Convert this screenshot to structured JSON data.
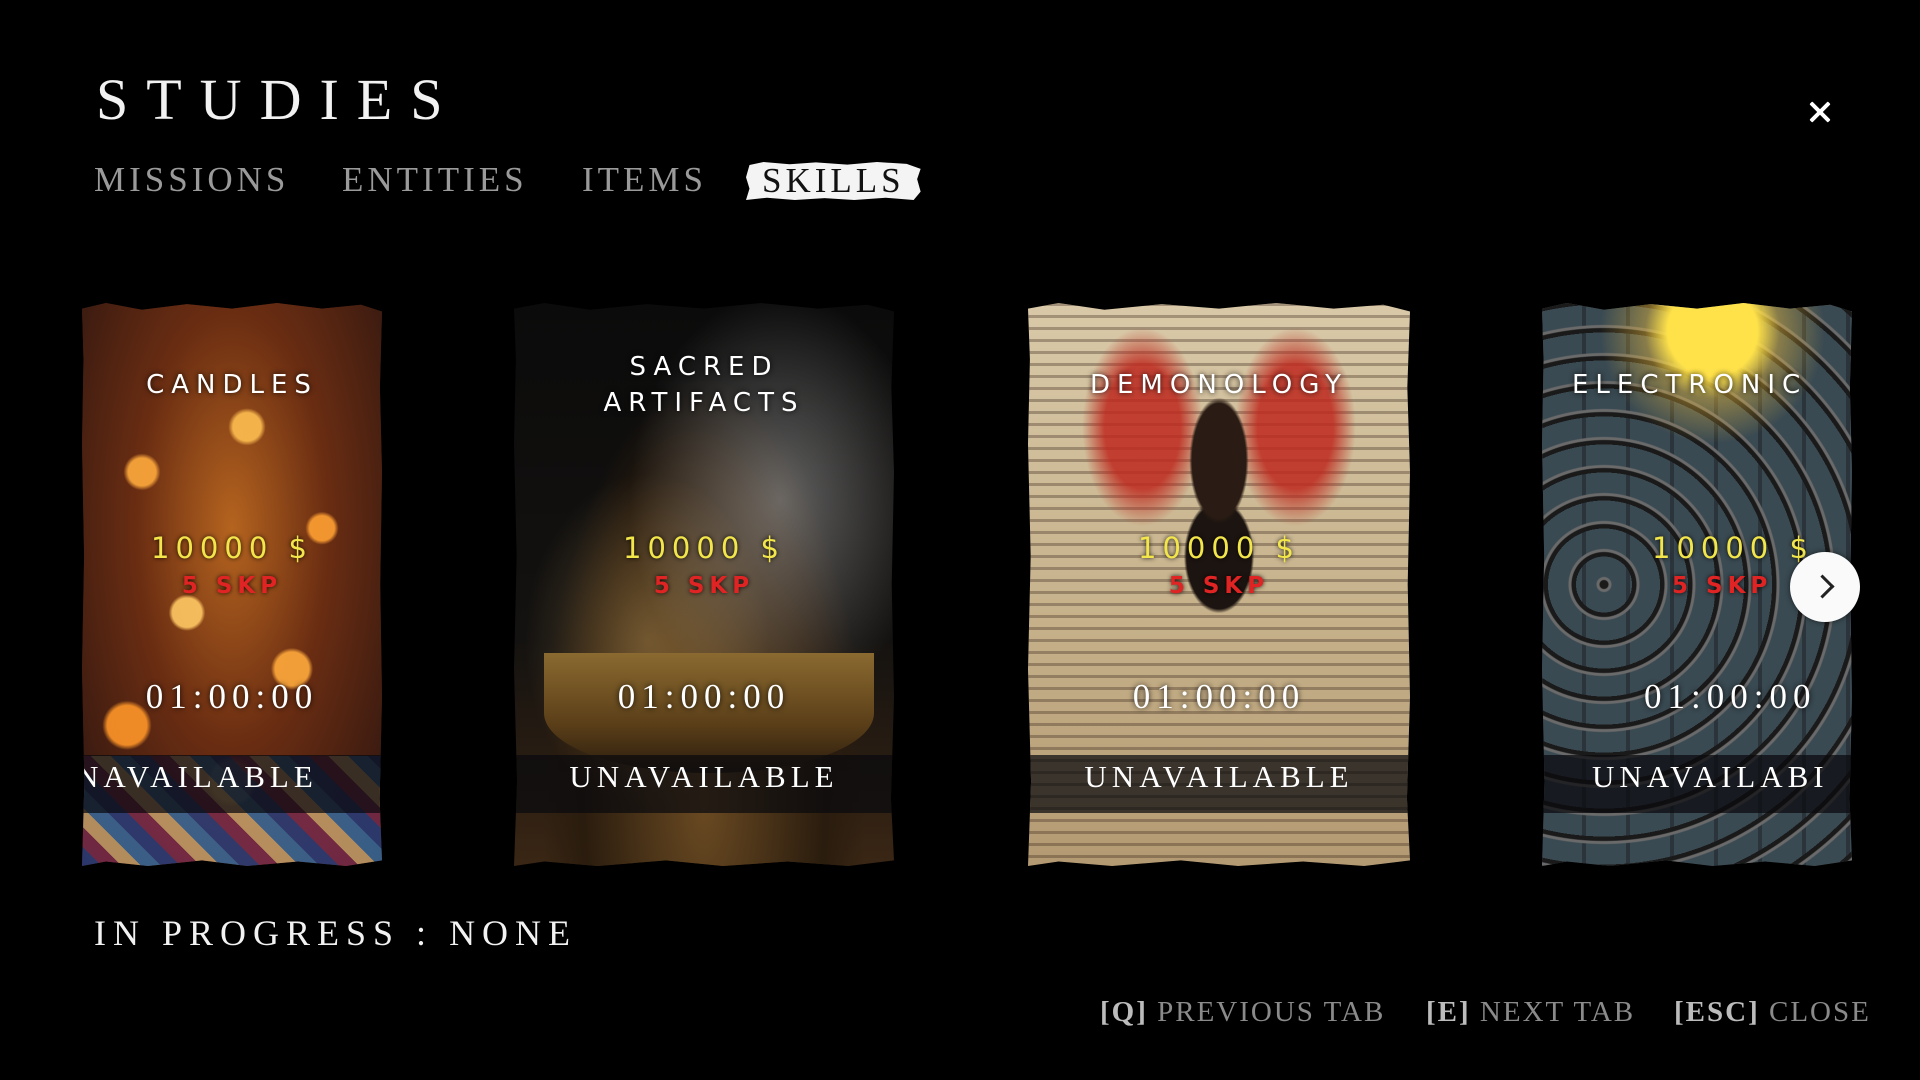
{
  "header": {
    "title": "STUDIES",
    "close_icon": "close-icon"
  },
  "tabs": [
    {
      "label": "MISSIONS",
      "active": false
    },
    {
      "label": "ENTITIES",
      "active": false
    },
    {
      "label": "ITEMS",
      "active": false
    },
    {
      "label": "SKILLS",
      "active": true
    }
  ],
  "cards": [
    {
      "name": "CANDLES",
      "price": "10000 $",
      "skp": "5 SKP",
      "time": "01:00:00",
      "status": "NAVAILABLE"
    },
    {
      "name": "SACRED\nARTIFACTS",
      "price": "10000 $",
      "skp": "5 SKP",
      "time": "01:00:00",
      "status": "UNAVAILABLE"
    },
    {
      "name": "DEMONOLOGY",
      "price": "10000 $",
      "skp": "5 SKP",
      "time": "01:00:00",
      "status": "UNAVAILABLE"
    },
    {
      "name": "ELECTRONIC",
      "price": "10000 $",
      "skp": "5 SKP",
      "time": "01:00:00",
      "status": "UNAVAILABI"
    }
  ],
  "carousel": {
    "next_icon": "chevron-right-icon"
  },
  "footer": {
    "in_progress": "IN PROGRESS : NONE",
    "hints": [
      {
        "key": "[Q]",
        "label": "PREVIOUS TAB"
      },
      {
        "key": "[E]",
        "label": "NEXT TAB"
      },
      {
        "key": "[ESC]",
        "label": "CLOSE"
      }
    ]
  }
}
